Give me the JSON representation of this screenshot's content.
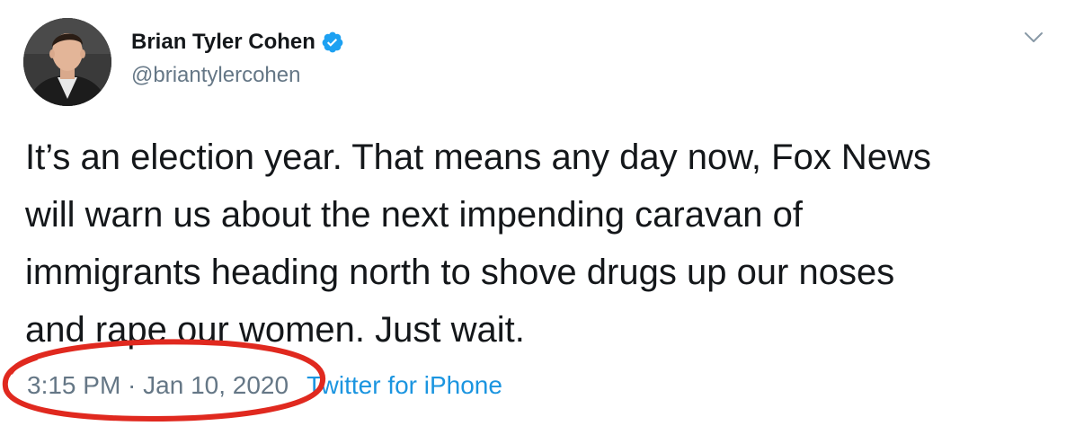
{
  "tweet": {
    "display_name": "Brian Tyler Cohen",
    "handle": "@briantylercohen",
    "verified": true,
    "text_lines": [
      "It’s an election year. That means any day now, Fox News",
      "will warn us about the next impending caravan of",
      "immigrants heading north to shove drugs up our noses",
      "and rape our women. Just wait."
    ],
    "timestamp": "3:15 PM · Jan 10, 2020",
    "source": "Twitter for iPhone"
  },
  "icons": {
    "verified": "verified-badge-icon",
    "menu": "chevron-down-icon"
  },
  "colors": {
    "text": "#14171a",
    "secondary": "#657786",
    "link": "#1b95e0",
    "verified": "#1da1f2",
    "annotation": "#e0291f"
  }
}
